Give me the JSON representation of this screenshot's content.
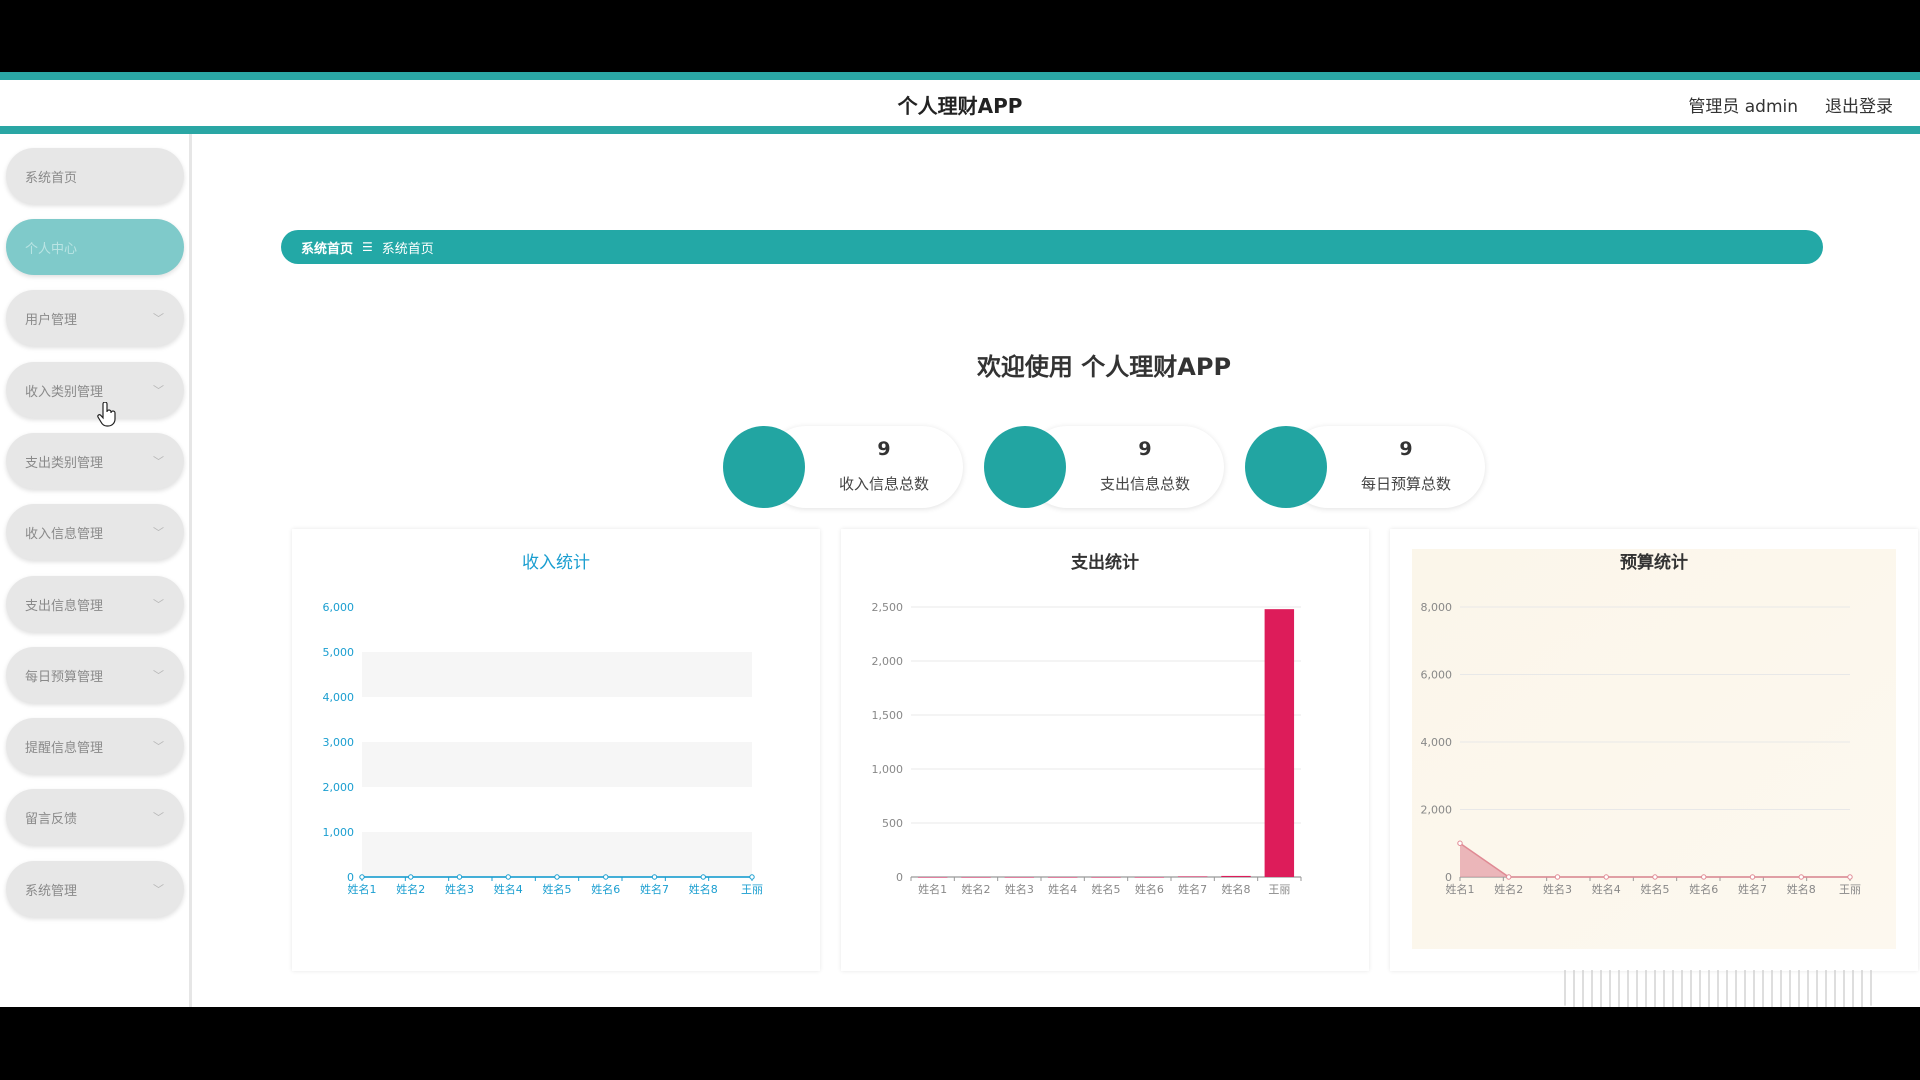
{
  "header": {
    "title": "个人理财APP",
    "admin": "管理员 admin",
    "logout": "退出登录"
  },
  "sidebar": {
    "items": [
      {
        "label": "系统首页",
        "active": false,
        "expandable": false
      },
      {
        "label": "个人中心",
        "active": true,
        "expandable": false
      },
      {
        "label": "用户管理",
        "active": false,
        "expandable": true
      },
      {
        "label": "收入类别管理",
        "active": false,
        "expandable": true
      },
      {
        "label": "支出类别管理",
        "active": false,
        "expandable": true
      },
      {
        "label": "收入信息管理",
        "active": false,
        "expandable": true
      },
      {
        "label": "支出信息管理",
        "active": false,
        "expandable": true
      },
      {
        "label": "每日预算管理",
        "active": false,
        "expandable": true
      },
      {
        "label": "提醒信息管理",
        "active": false,
        "expandable": true
      },
      {
        "label": "留言反馈",
        "active": false,
        "expandable": true
      },
      {
        "label": "系统管理",
        "active": false,
        "expandable": true
      }
    ]
  },
  "breadcrumb": {
    "home": "系统首页",
    "separator": "☰",
    "current": "系统首页"
  },
  "welcome": "欢迎使用 个人理财APP",
  "stats": [
    {
      "value": "9",
      "label": "收入信息总数"
    },
    {
      "value": "9",
      "label": "支出信息总数"
    },
    {
      "value": "9",
      "label": "每日预算总数"
    }
  ],
  "colors": {
    "accent": "#23a8a6",
    "income_axis": "#1a9ed0",
    "expense_bar": "#dd1c5a",
    "budget_area": "#e6a0a8"
  },
  "chart_data": [
    {
      "type": "line",
      "title": "收入统计",
      "categories": [
        "姓名1",
        "姓名2",
        "姓名3",
        "姓名4",
        "姓名5",
        "姓名6",
        "姓名7",
        "姓名8",
        "王丽"
      ],
      "values": [
        0,
        0,
        0,
        0,
        0,
        0,
        0,
        0,
        0
      ],
      "ylim": [
        0,
        6000
      ],
      "yticks": [
        0,
        1000,
        2000,
        3000,
        4000,
        5000,
        6000
      ],
      "ytick_labels": [
        "0",
        "1,000",
        "2,000",
        "3,000",
        "4,000",
        "5,000",
        "6,000"
      ],
      "grid": "banded"
    },
    {
      "type": "bar",
      "title": "支出统计",
      "categories": [
        "姓名1",
        "姓名2",
        "姓名3",
        "姓名4",
        "姓名5",
        "姓名6",
        "姓名7",
        "姓名8",
        "王丽"
      ],
      "values": [
        0,
        0,
        0,
        0,
        0,
        0,
        5,
        10,
        2480
      ],
      "ylim": [
        0,
        2500
      ],
      "yticks": [
        0,
        500,
        1000,
        1500,
        2000,
        2500
      ],
      "ytick_labels": [
        "0",
        "500",
        "1,000",
        "1,500",
        "2,000",
        "2,500"
      ],
      "grid": true
    },
    {
      "type": "area",
      "title": "预算统计",
      "categories": [
        "姓名1",
        "姓名2",
        "姓名3",
        "姓名4",
        "姓名5",
        "姓名6",
        "姓名7",
        "姓名8",
        "王丽"
      ],
      "values": [
        1000,
        0,
        0,
        0,
        0,
        0,
        0,
        0,
        0
      ],
      "ylim": [
        0,
        8000
      ],
      "yticks": [
        0,
        2000,
        4000,
        6000,
        8000
      ],
      "ytick_labels": [
        "0",
        "2,000",
        "4,000",
        "6,000",
        "8,000"
      ],
      "grid": true
    }
  ]
}
